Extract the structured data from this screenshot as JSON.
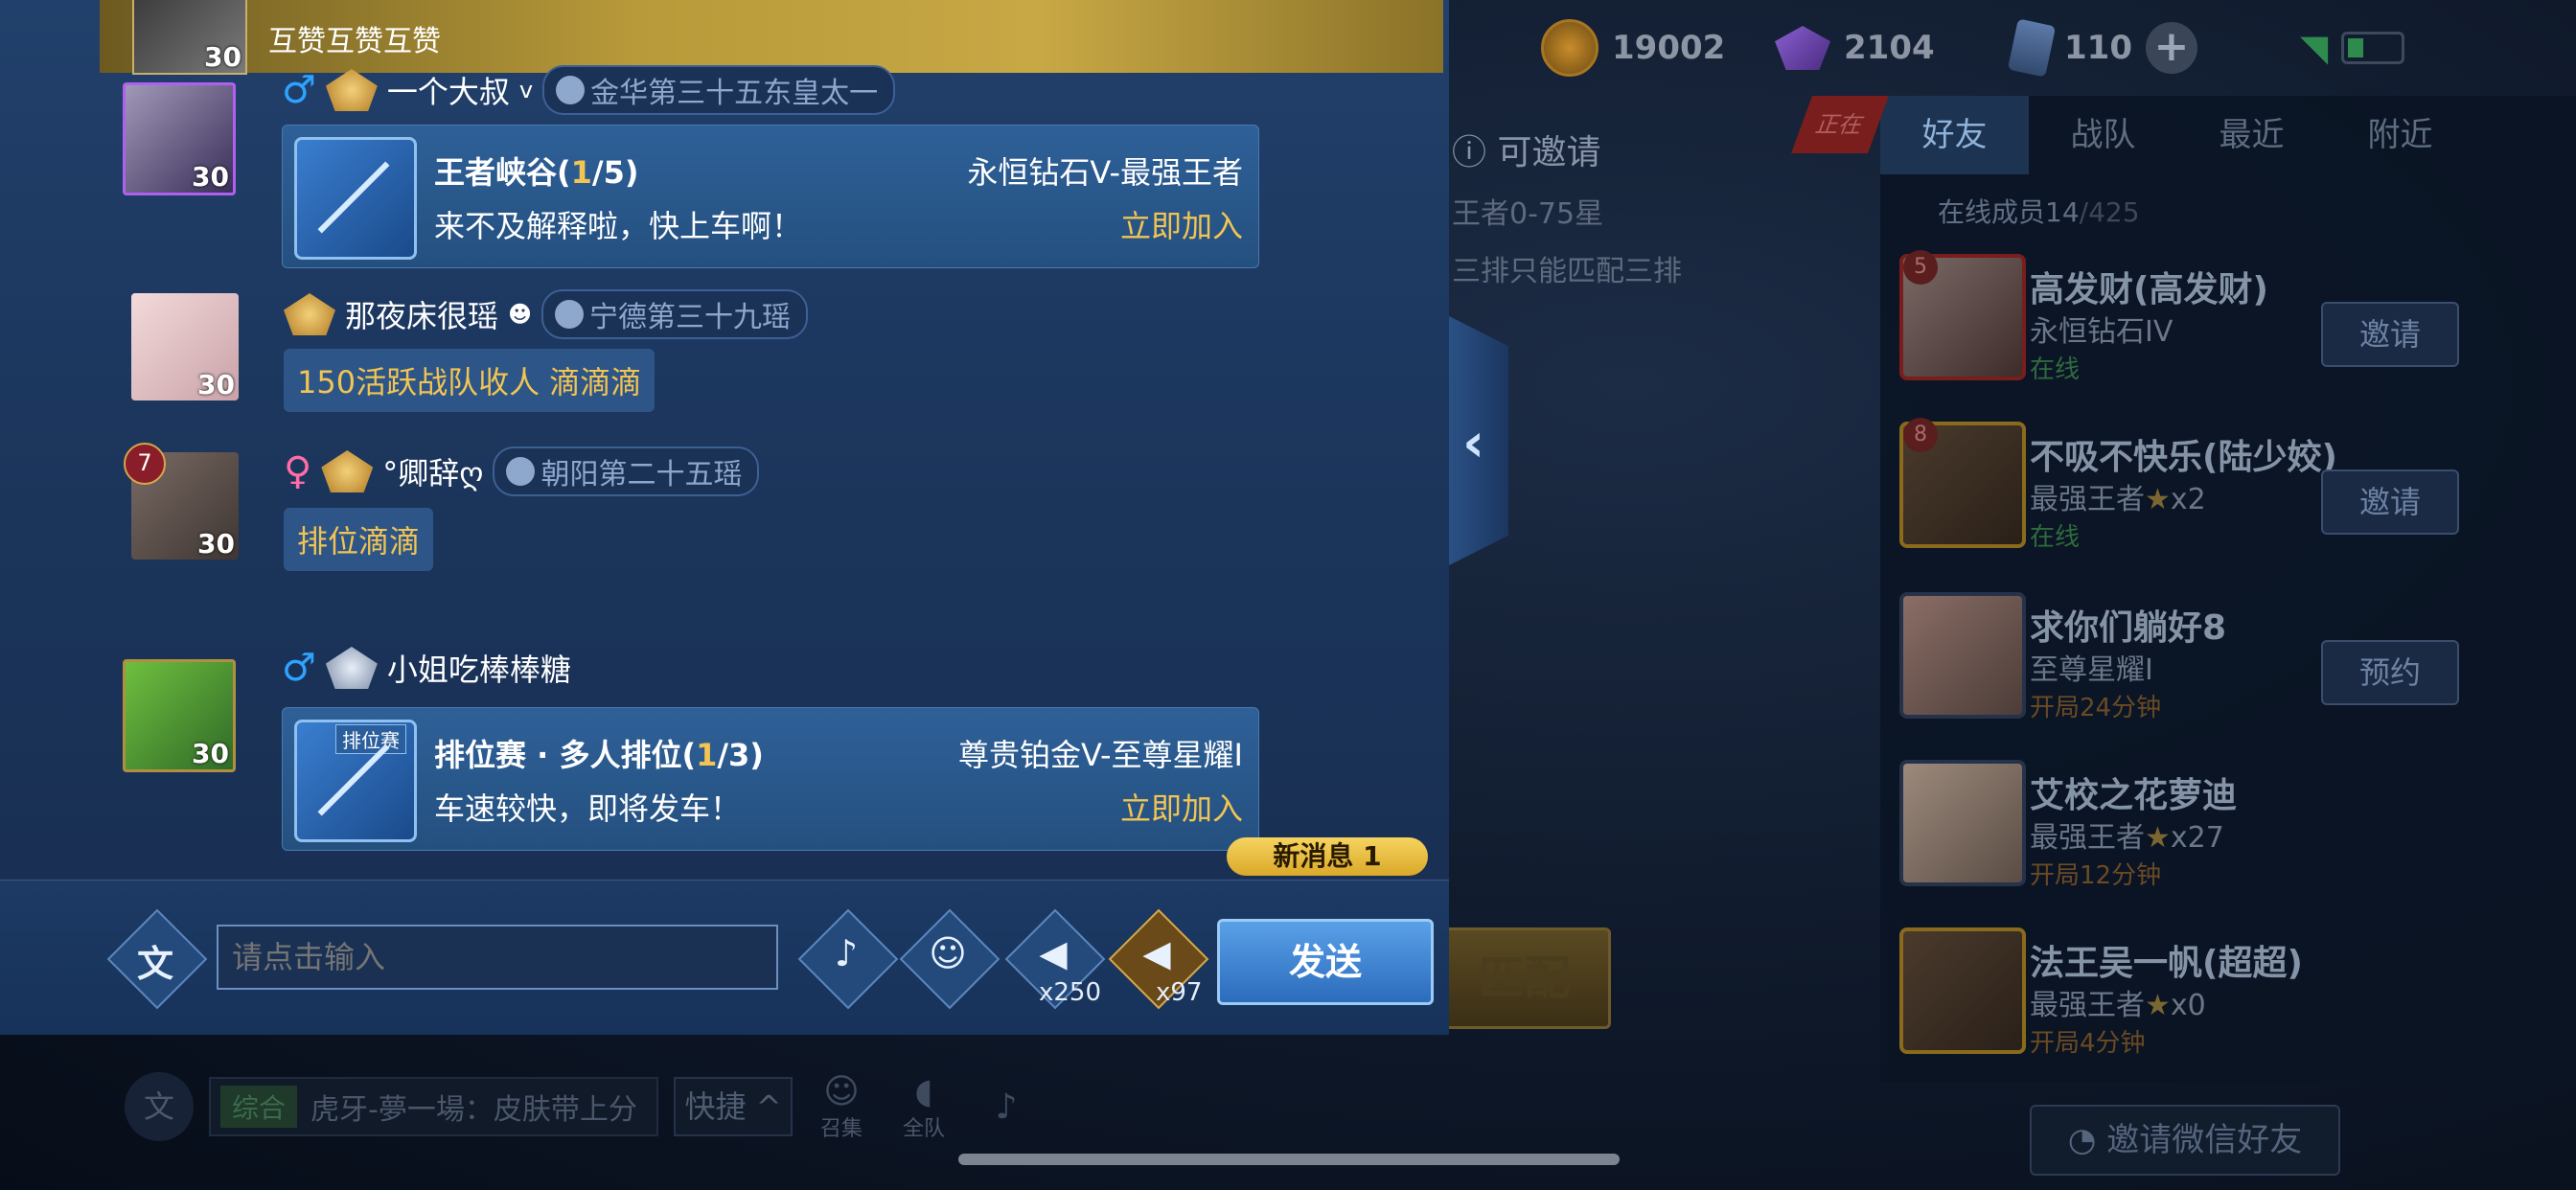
{
  "resources": {
    "coins": "19002",
    "diamonds": "2104",
    "tickets": "110"
  },
  "lobby": {
    "invite_title": "可邀请",
    "invite_range": "王者0-75星",
    "invite_note": "三排只能匹配三排",
    "match_label": "匹配",
    "ribbon": "正在"
  },
  "friends_panel": {
    "tabs": [
      "好友",
      "战队",
      "最近",
      "附近"
    ],
    "online_label": "在线成员",
    "online_count": "14",
    "online_total": "/425",
    "friends": [
      {
        "badge": "5",
        "name": "高发财(高发财)",
        "rank": "永恒钻石IV",
        "status": "在线",
        "action": "邀请"
      },
      {
        "badge": "8",
        "name": "不吸不快乐(陆少姣)",
        "rank": "最强王者",
        "stars": "x2",
        "status": "在线",
        "action": "邀请"
      },
      {
        "name": "求你们躺好8",
        "rank": "至尊星耀I",
        "status": "开局24分钟",
        "action": "预约"
      },
      {
        "name": "艾校之花萝迪",
        "rank": "最强王者",
        "stars": "x27",
        "status": "开局12分钟"
      },
      {
        "name": "法王吴一帆(超超)",
        "rank": "最强王者",
        "stars": "x0",
        "status": "开局4分钟"
      }
    ],
    "wechat_invite": "邀请微信好友"
  },
  "bottom_bar": {
    "channel_tag": "综合",
    "last_message": "虎牙-夢一場：皮肤带上分",
    "quick_label": "快捷",
    "summon_label": "召集",
    "team_label": "全队"
  },
  "chat": {
    "banner": {
      "level": "30",
      "text": "互赞互赞互赞"
    },
    "messages": [
      {
        "level": "30",
        "name": "一个大叔",
        "name_suffix": "v",
        "region": "金华第三十五东皇太一",
        "card": {
          "mode": "王者峡谷(",
          "num": "1",
          "total": "/5)",
          "rank": "永恒钻石V-最强王者",
          "desc": "来不及解释啦，快上车啊！",
          "join": "立即加入"
        }
      },
      {
        "level": "30",
        "name": "那夜床很瑶",
        "name_suffix": "☻",
        "region": "宁德第三十九瑶",
        "text": "150活跃战队收人  滴滴滴"
      },
      {
        "badge": "7",
        "level": "30",
        "name": "°卿辞ღ",
        "region": "朝阳第二十五瑶",
        "text": "排位滴滴"
      },
      {
        "level": "30",
        "name": "小姐吃棒棒糖",
        "card": {
          "tag": "排位赛",
          "mode": "排位赛 · 多人排位(",
          "num": "1",
          "total": "/3)",
          "rank": "尊贵铂金V-至尊星耀I",
          "desc": "车速较快，即将发车！",
          "join": "立即加入"
        }
      }
    ],
    "new_message": "新消息 1",
    "input_placeholder": "请点击输入",
    "horn_small_count": "x250",
    "horn_big_count": "x97",
    "send_label": "发送",
    "translate_glyph": "文"
  }
}
